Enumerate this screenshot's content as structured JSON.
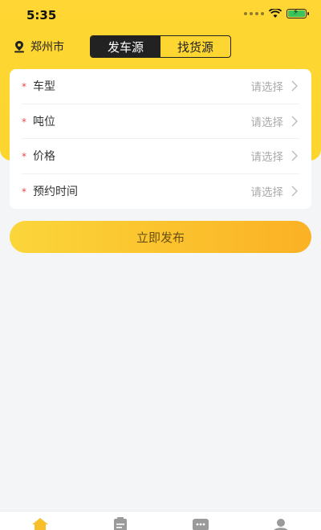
{
  "status_bar": {
    "time": "5:35"
  },
  "header": {
    "city": "郑州市",
    "tabs": [
      {
        "label": "发车源",
        "active": true
      },
      {
        "label": "找货源",
        "active": false
      }
    ]
  },
  "form": {
    "rows": [
      {
        "label": "车型",
        "value": "请选择"
      },
      {
        "label": "吨位",
        "value": "请选择"
      },
      {
        "label": "价格",
        "value": "请选择"
      },
      {
        "label": "预约时间",
        "value": "请选择"
      }
    ],
    "required_mark": "*"
  },
  "publish_button": {
    "label": "立即发布"
  },
  "colors": {
    "brand_yellow": "#fcd52f",
    "accent_orange": "#fbb124",
    "dark": "#222222"
  },
  "tabbar": {
    "icons": [
      "home-icon",
      "clipboard-icon",
      "message-icon",
      "user-icon"
    ]
  }
}
